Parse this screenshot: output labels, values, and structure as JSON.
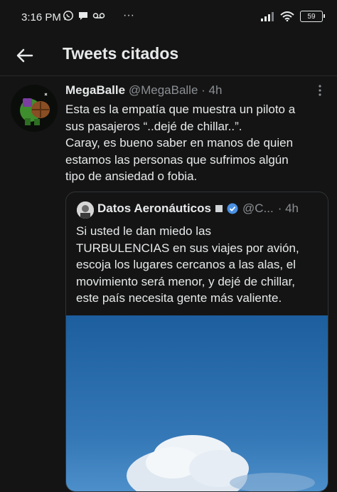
{
  "status_bar": {
    "time": "3:16 PM",
    "app_icons": [
      "whatsapp-icon",
      "message-icon",
      "voicemail-icon"
    ],
    "more": "···",
    "battery": "59",
    "right_icons": [
      "signal-icon",
      "wifi-icon",
      "battery-icon"
    ]
  },
  "header": {
    "title": "Tweets citados",
    "back_icon": "arrow-left-icon"
  },
  "tweet": {
    "display_name": "MegaBalle",
    "handle": "@MegaBalle",
    "time": "· 4h",
    "lines": [
      "Esta es la empatía que muestra un piloto a",
      "sus pasajeros “..dejé de chillar..”.",
      "Caray, es bueno saber en manos de quien",
      "estamos las personas que sufrimos algún",
      "tipo de ansiedad o fobia."
    ]
  },
  "quoted_tweet": {
    "display_name": "Datos Aeronáuticos",
    "handle": "@C...",
    "time": "· 4h",
    "verified_color": "#4a90e2",
    "lines": [
      "Si usted le dan miedo las",
      "TURBULENCIAS en sus viajes por avión,",
      "escoja los lugares cercanos a las alas, el",
      "movimiento será menor, y dejé de chillar,",
      "este país necesita gente más valiente."
    ]
  },
  "colors": {
    "background": "#141414",
    "text": "#e7e9ea",
    "muted": "#8b8f93",
    "sky_top": "#1c5e9e",
    "sky_bottom": "#4c8fca"
  }
}
